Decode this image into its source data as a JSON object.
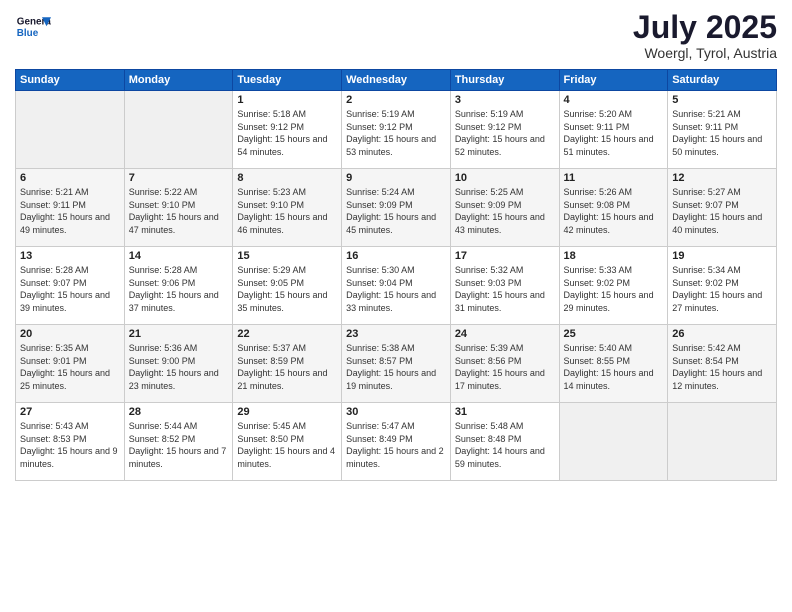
{
  "header": {
    "logo_line1": "General",
    "logo_line2": "Blue",
    "month_year": "July 2025",
    "location": "Woergl, Tyrol, Austria"
  },
  "days_of_week": [
    "Sunday",
    "Monday",
    "Tuesday",
    "Wednesday",
    "Thursday",
    "Friday",
    "Saturday"
  ],
  "weeks": [
    [
      {
        "day": "",
        "sunrise": "",
        "sunset": "",
        "daylight": ""
      },
      {
        "day": "",
        "sunrise": "",
        "sunset": "",
        "daylight": ""
      },
      {
        "day": "1",
        "sunrise": "Sunrise: 5:18 AM",
        "sunset": "Sunset: 9:12 PM",
        "daylight": "Daylight: 15 hours and 54 minutes."
      },
      {
        "day": "2",
        "sunrise": "Sunrise: 5:19 AM",
        "sunset": "Sunset: 9:12 PM",
        "daylight": "Daylight: 15 hours and 53 minutes."
      },
      {
        "day": "3",
        "sunrise": "Sunrise: 5:19 AM",
        "sunset": "Sunset: 9:12 PM",
        "daylight": "Daylight: 15 hours and 52 minutes."
      },
      {
        "day": "4",
        "sunrise": "Sunrise: 5:20 AM",
        "sunset": "Sunset: 9:11 PM",
        "daylight": "Daylight: 15 hours and 51 minutes."
      },
      {
        "day": "5",
        "sunrise": "Sunrise: 5:21 AM",
        "sunset": "Sunset: 9:11 PM",
        "daylight": "Daylight: 15 hours and 50 minutes."
      }
    ],
    [
      {
        "day": "6",
        "sunrise": "Sunrise: 5:21 AM",
        "sunset": "Sunset: 9:11 PM",
        "daylight": "Daylight: 15 hours and 49 minutes."
      },
      {
        "day": "7",
        "sunrise": "Sunrise: 5:22 AM",
        "sunset": "Sunset: 9:10 PM",
        "daylight": "Daylight: 15 hours and 47 minutes."
      },
      {
        "day": "8",
        "sunrise": "Sunrise: 5:23 AM",
        "sunset": "Sunset: 9:10 PM",
        "daylight": "Daylight: 15 hours and 46 minutes."
      },
      {
        "day": "9",
        "sunrise": "Sunrise: 5:24 AM",
        "sunset": "Sunset: 9:09 PM",
        "daylight": "Daylight: 15 hours and 45 minutes."
      },
      {
        "day": "10",
        "sunrise": "Sunrise: 5:25 AM",
        "sunset": "Sunset: 9:09 PM",
        "daylight": "Daylight: 15 hours and 43 minutes."
      },
      {
        "day": "11",
        "sunrise": "Sunrise: 5:26 AM",
        "sunset": "Sunset: 9:08 PM",
        "daylight": "Daylight: 15 hours and 42 minutes."
      },
      {
        "day": "12",
        "sunrise": "Sunrise: 5:27 AM",
        "sunset": "Sunset: 9:07 PM",
        "daylight": "Daylight: 15 hours and 40 minutes."
      }
    ],
    [
      {
        "day": "13",
        "sunrise": "Sunrise: 5:28 AM",
        "sunset": "Sunset: 9:07 PM",
        "daylight": "Daylight: 15 hours and 39 minutes."
      },
      {
        "day": "14",
        "sunrise": "Sunrise: 5:28 AM",
        "sunset": "Sunset: 9:06 PM",
        "daylight": "Daylight: 15 hours and 37 minutes."
      },
      {
        "day": "15",
        "sunrise": "Sunrise: 5:29 AM",
        "sunset": "Sunset: 9:05 PM",
        "daylight": "Daylight: 15 hours and 35 minutes."
      },
      {
        "day": "16",
        "sunrise": "Sunrise: 5:30 AM",
        "sunset": "Sunset: 9:04 PM",
        "daylight": "Daylight: 15 hours and 33 minutes."
      },
      {
        "day": "17",
        "sunrise": "Sunrise: 5:32 AM",
        "sunset": "Sunset: 9:03 PM",
        "daylight": "Daylight: 15 hours and 31 minutes."
      },
      {
        "day": "18",
        "sunrise": "Sunrise: 5:33 AM",
        "sunset": "Sunset: 9:02 PM",
        "daylight": "Daylight: 15 hours and 29 minutes."
      },
      {
        "day": "19",
        "sunrise": "Sunrise: 5:34 AM",
        "sunset": "Sunset: 9:02 PM",
        "daylight": "Daylight: 15 hours and 27 minutes."
      }
    ],
    [
      {
        "day": "20",
        "sunrise": "Sunrise: 5:35 AM",
        "sunset": "Sunset: 9:01 PM",
        "daylight": "Daylight: 15 hours and 25 minutes."
      },
      {
        "day": "21",
        "sunrise": "Sunrise: 5:36 AM",
        "sunset": "Sunset: 9:00 PM",
        "daylight": "Daylight: 15 hours and 23 minutes."
      },
      {
        "day": "22",
        "sunrise": "Sunrise: 5:37 AM",
        "sunset": "Sunset: 8:59 PM",
        "daylight": "Daylight: 15 hours and 21 minutes."
      },
      {
        "day": "23",
        "sunrise": "Sunrise: 5:38 AM",
        "sunset": "Sunset: 8:57 PM",
        "daylight": "Daylight: 15 hours and 19 minutes."
      },
      {
        "day": "24",
        "sunrise": "Sunrise: 5:39 AM",
        "sunset": "Sunset: 8:56 PM",
        "daylight": "Daylight: 15 hours and 17 minutes."
      },
      {
        "day": "25",
        "sunrise": "Sunrise: 5:40 AM",
        "sunset": "Sunset: 8:55 PM",
        "daylight": "Daylight: 15 hours and 14 minutes."
      },
      {
        "day": "26",
        "sunrise": "Sunrise: 5:42 AM",
        "sunset": "Sunset: 8:54 PM",
        "daylight": "Daylight: 15 hours and 12 minutes."
      }
    ],
    [
      {
        "day": "27",
        "sunrise": "Sunrise: 5:43 AM",
        "sunset": "Sunset: 8:53 PM",
        "daylight": "Daylight: 15 hours and 9 minutes."
      },
      {
        "day": "28",
        "sunrise": "Sunrise: 5:44 AM",
        "sunset": "Sunset: 8:52 PM",
        "daylight": "Daylight: 15 hours and 7 minutes."
      },
      {
        "day": "29",
        "sunrise": "Sunrise: 5:45 AM",
        "sunset": "Sunset: 8:50 PM",
        "daylight": "Daylight: 15 hours and 4 minutes."
      },
      {
        "day": "30",
        "sunrise": "Sunrise: 5:47 AM",
        "sunset": "Sunset: 8:49 PM",
        "daylight": "Daylight: 15 hours and 2 minutes."
      },
      {
        "day": "31",
        "sunrise": "Sunrise: 5:48 AM",
        "sunset": "Sunset: 8:48 PM",
        "daylight": "Daylight: 14 hours and 59 minutes."
      },
      {
        "day": "",
        "sunrise": "",
        "sunset": "",
        "daylight": ""
      },
      {
        "day": "",
        "sunrise": "",
        "sunset": "",
        "daylight": ""
      }
    ]
  ]
}
